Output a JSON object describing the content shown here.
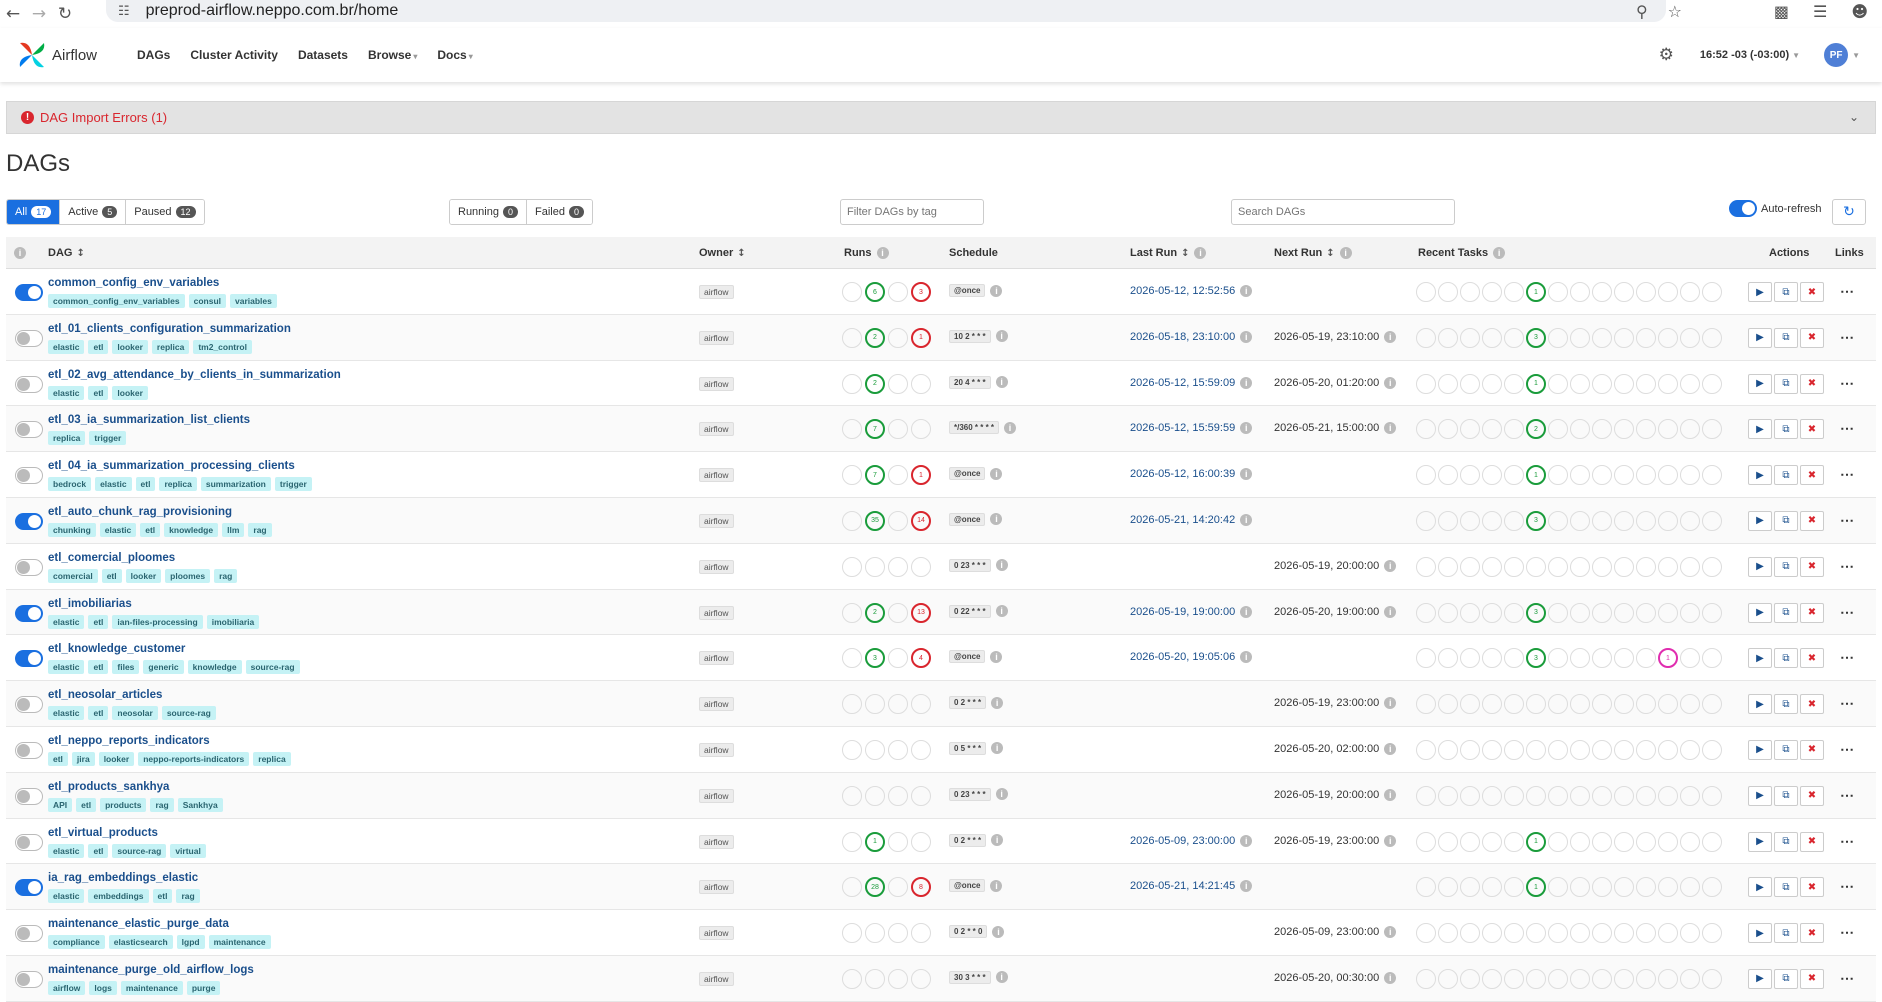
{
  "browser": {
    "url": "preprod-airflow.neppo.com.br/home"
  },
  "navbar": {
    "brand": "Airflow",
    "links": [
      {
        "label": "DAGs",
        "caret": false
      },
      {
        "label": "Cluster Activity",
        "caret": false
      },
      {
        "label": "Datasets",
        "caret": false
      },
      {
        "label": "Browse",
        "caret": true
      },
      {
        "label": "Docs",
        "caret": true
      }
    ],
    "time": "16:52 -03 (-03:00)",
    "avatar": "PF"
  },
  "import_errors": {
    "label": "DAG Import Errors (1)"
  },
  "page_title": "DAGs",
  "filters": {
    "status": [
      {
        "label": "All",
        "count": "17",
        "active": true
      },
      {
        "label": "Active",
        "count": "5",
        "active": false
      },
      {
        "label": "Paused",
        "count": "12",
        "active": false
      }
    ],
    "state": [
      {
        "label": "Running",
        "count": "0"
      },
      {
        "label": "Failed",
        "count": "0"
      }
    ],
    "tag_placeholder": "Filter DAGs by tag",
    "search_placeholder": "Search DAGs",
    "auto_refresh": "Auto-refresh"
  },
  "columns": {
    "dag": "DAG",
    "owner": "Owner",
    "runs": "Runs",
    "schedule": "Schedule",
    "last_run": "Last Run",
    "next_run": "Next Run",
    "recent_tasks": "Recent Tasks",
    "actions": "Actions",
    "links": "Links"
  },
  "dags": [
    {
      "name": "common_config_env_variables",
      "active": true,
      "tags": [
        "common_config_env_variables",
        "consul",
        "variables"
      ],
      "owner": "airflow",
      "runs": [
        null,
        {
          "v": "6",
          "c": "green"
        },
        null,
        {
          "v": "3",
          "c": "red"
        }
      ],
      "schedule": "@once",
      "last_run": "2026-05-12, 12:52:56",
      "next_run": "",
      "task_idx": 5,
      "task_val": "1",
      "task_color": "green"
    },
    {
      "name": "etl_01_clients_configuration_summarization",
      "active": false,
      "tags": [
        "elastic",
        "etl",
        "looker",
        "replica",
        "tm2_control"
      ],
      "owner": "airflow",
      "runs": [
        null,
        {
          "v": "2",
          "c": "green"
        },
        null,
        {
          "v": "1",
          "c": "red"
        }
      ],
      "schedule": "10 2 * * *",
      "last_run": "2026-05-18, 23:10:00",
      "next_run": "2026-05-19, 23:10:00",
      "task_idx": 5,
      "task_val": "3",
      "task_color": "green"
    },
    {
      "name": "etl_02_avg_attendance_by_clients_in_summarization",
      "active": false,
      "tags": [
        "elastic",
        "etl",
        "looker"
      ],
      "owner": "airflow",
      "runs": [
        null,
        {
          "v": "2",
          "c": "green"
        },
        null,
        null
      ],
      "schedule": "20 4 * * *",
      "last_run": "2026-05-12, 15:59:09",
      "next_run": "2026-05-20, 01:20:00",
      "task_idx": 5,
      "task_val": "1",
      "task_color": "green"
    },
    {
      "name": "etl_03_ia_summarization_list_clients",
      "active": false,
      "tags": [
        "replica",
        "trigger"
      ],
      "owner": "airflow",
      "runs": [
        null,
        {
          "v": "7",
          "c": "green"
        },
        null,
        null
      ],
      "schedule": "*/360 * * * *",
      "last_run": "2026-05-12, 15:59:59",
      "next_run": "2026-05-21, 15:00:00",
      "task_idx": 5,
      "task_val": "2",
      "task_color": "green"
    },
    {
      "name": "etl_04_ia_summarization_processing_clients",
      "active": false,
      "tags": [
        "bedrock",
        "elastic",
        "etl",
        "replica",
        "summarization",
        "trigger"
      ],
      "owner": "airflow",
      "runs": [
        null,
        {
          "v": "7",
          "c": "green"
        },
        null,
        {
          "v": "1",
          "c": "red"
        }
      ],
      "schedule": "@once",
      "last_run": "2026-05-12, 16:00:39",
      "next_run": "",
      "task_idx": 5,
      "task_val": "1",
      "task_color": "green"
    },
    {
      "name": "etl_auto_chunk_rag_provisioning",
      "active": true,
      "tags": [
        "chunking",
        "elastic",
        "etl",
        "knowledge",
        "llm",
        "rag"
      ],
      "owner": "airflow",
      "runs": [
        null,
        {
          "v": "35",
          "c": "green"
        },
        null,
        {
          "v": "14",
          "c": "red"
        }
      ],
      "schedule": "@once",
      "last_run": "2026-05-21, 14:20:42",
      "next_run": "",
      "task_idx": 5,
      "task_val": "3",
      "task_color": "green"
    },
    {
      "name": "etl_comercial_ploomes",
      "active": false,
      "tags": [
        "comercial",
        "etl",
        "looker",
        "ploomes",
        "rag"
      ],
      "owner": "airflow",
      "runs": [
        null,
        null,
        null,
        null
      ],
      "schedule": "0 23 * * *",
      "last_run": "",
      "next_run": "2026-05-19, 20:00:00",
      "task_idx": -1,
      "task_val": "",
      "task_color": ""
    },
    {
      "name": "etl_imobiliarias",
      "active": true,
      "tags": [
        "elastic",
        "etl",
        "ian-files-processing",
        "imobiliaria"
      ],
      "owner": "airflow",
      "runs": [
        null,
        {
          "v": "2",
          "c": "green"
        },
        null,
        {
          "v": "13",
          "c": "red"
        }
      ],
      "schedule": "0 22 * * *",
      "last_run": "2026-05-19, 19:00:00",
      "next_run": "2026-05-20, 19:00:00",
      "task_idx": 5,
      "task_val": "3",
      "task_color": "green"
    },
    {
      "name": "etl_knowledge_customer",
      "active": true,
      "tags": [
        "elastic",
        "etl",
        "files",
        "generic",
        "knowledge",
        "source-rag"
      ],
      "owner": "airflow",
      "runs": [
        null,
        {
          "v": "3",
          "c": "green"
        },
        null,
        {
          "v": "4",
          "c": "red"
        }
      ],
      "schedule": "@once",
      "last_run": "2026-05-20, 19:05:06",
      "next_run": "",
      "task_idx": 5,
      "task_val": "3",
      "task_color": "green",
      "task2_idx": 11,
      "task2_val": "1",
      "task2_color": "pink"
    },
    {
      "name": "etl_neosolar_articles",
      "active": false,
      "tags": [
        "elastic",
        "etl",
        "neosolar",
        "source-rag"
      ],
      "owner": "airflow",
      "runs": [
        null,
        null,
        null,
        null
      ],
      "schedule": "0 2 * * *",
      "last_run": "",
      "next_run": "2026-05-19, 23:00:00",
      "task_idx": -1,
      "task_val": "",
      "task_color": ""
    },
    {
      "name": "etl_neppo_reports_indicators",
      "active": false,
      "tags": [
        "etl",
        "jira",
        "looker",
        "neppo-reports-indicators",
        "replica"
      ],
      "owner": "airflow",
      "runs": [
        null,
        null,
        null,
        null
      ],
      "schedule": "0 5 * * *",
      "last_run": "",
      "next_run": "2026-05-20, 02:00:00",
      "task_idx": -1,
      "task_val": "",
      "task_color": ""
    },
    {
      "name": "etl_products_sankhya",
      "active": false,
      "tags": [
        "API",
        "etl",
        "products",
        "rag",
        "Sankhya"
      ],
      "owner": "airflow",
      "runs": [
        null,
        null,
        null,
        null
      ],
      "schedule": "0 23 * * *",
      "last_run": "",
      "next_run": "2026-05-19, 20:00:00",
      "task_idx": -1,
      "task_val": "",
      "task_color": ""
    },
    {
      "name": "etl_virtual_products",
      "active": false,
      "tags": [
        "elastic",
        "etl",
        "source-rag",
        "virtual"
      ],
      "owner": "airflow",
      "runs": [
        null,
        {
          "v": "1",
          "c": "green"
        },
        null,
        null
      ],
      "schedule": "0 2 * * *",
      "last_run": "2026-05-09, 23:00:00",
      "next_run": "2026-05-19, 23:00:00",
      "task_idx": 5,
      "task_val": "1",
      "task_color": "green"
    },
    {
      "name": "ia_rag_embeddings_elastic",
      "active": true,
      "tags": [
        "elastic",
        "embeddings",
        "etl",
        "rag"
      ],
      "owner": "airflow",
      "runs": [
        null,
        {
          "v": "28",
          "c": "green"
        },
        null,
        {
          "v": "8",
          "c": "red"
        }
      ],
      "schedule": "@once",
      "last_run": "2026-05-21, 14:21:45",
      "next_run": "",
      "task_idx": 5,
      "task_val": "1",
      "task_color": "green"
    },
    {
      "name": "maintenance_elastic_purge_data",
      "active": false,
      "tags": [
        "compliance",
        "elasticsearch",
        "lgpd",
        "maintenance"
      ],
      "owner": "airflow",
      "runs": [
        null,
        null,
        null,
        null
      ],
      "schedule": "0 2 * * 0",
      "last_run": "",
      "next_run": "2026-05-09, 23:00:00",
      "task_idx": -1,
      "task_val": "",
      "task_color": ""
    },
    {
      "name": "maintenance_purge_old_airflow_logs",
      "active": false,
      "tags": [
        "airflow",
        "logs",
        "maintenance",
        "purge"
      ],
      "owner": "airflow",
      "runs": [
        null,
        null,
        null,
        null
      ],
      "schedule": "30 3 * * *",
      "last_run": "",
      "next_run": "2026-05-20, 00:30:00",
      "task_idx": -1,
      "task_val": "",
      "task_color": ""
    }
  ],
  "colors": {
    "primary": "#1a6fe0",
    "success": "#1a9c3b",
    "failed": "#d9262e",
    "tag_bg": "#c5f2f5",
    "link": "#1a4f8c"
  }
}
